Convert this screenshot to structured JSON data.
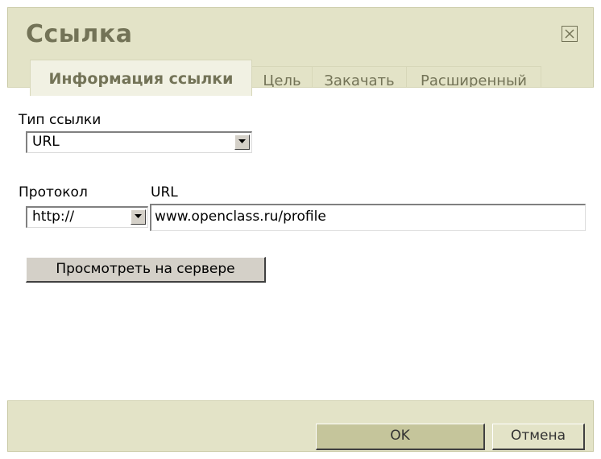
{
  "dialog": {
    "title": "Ссылка",
    "close_icon": "close-icon"
  },
  "tabs": [
    {
      "label": "Информация ссылки",
      "active": true
    },
    {
      "label": "Цель",
      "active": false
    },
    {
      "label": "Закачать",
      "active": false
    },
    {
      "label": "Расширенный",
      "active": false
    }
  ],
  "form": {
    "link_type_label": "Тип ссылки",
    "link_type_value": "URL",
    "protocol_label": "Протокол",
    "protocol_value": "http://",
    "url_label": "URL",
    "url_value": "www.openclass.ru/profile",
    "browse_server_label": "Просмотреть на сервере"
  },
  "footer": {
    "ok_label": "OK",
    "cancel_label": "Отмена"
  },
  "colors": {
    "dialog_bg": "#e3e3c7",
    "title": "#737357",
    "ok_button": "#c5c59b"
  }
}
